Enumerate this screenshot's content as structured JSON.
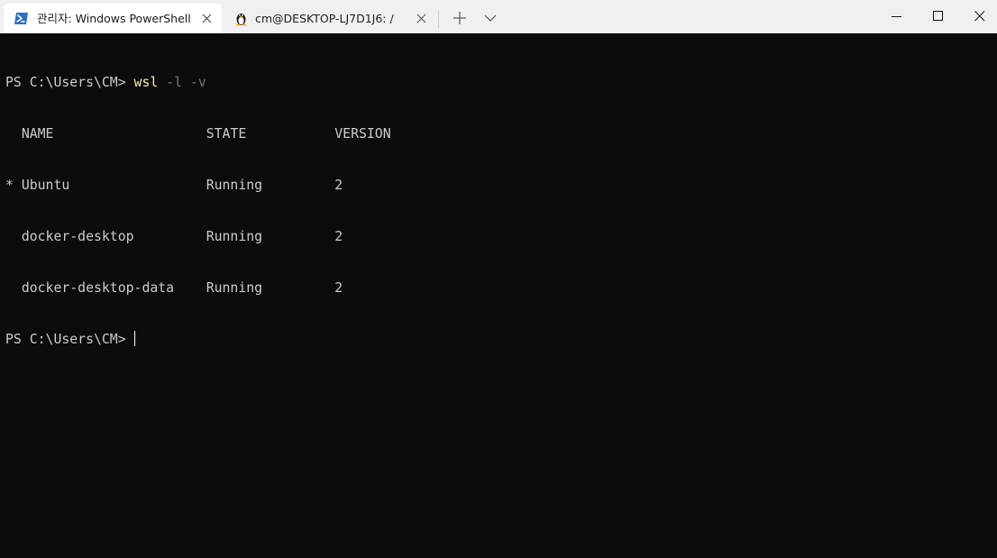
{
  "tabs": [
    {
      "title": "관리자: Windows PowerShell",
      "icon": "powershell-icon",
      "active": true
    },
    {
      "title": "cm@DESKTOP-LJ7D1J6: /",
      "icon": "linux-tux-icon",
      "active": false
    }
  ],
  "toolbar": {
    "new_tab_icon": "plus-icon",
    "dropdown_icon": "chevron-down-icon"
  },
  "window_controls": [
    "minimize-icon",
    "maximize-icon",
    "close-icon"
  ],
  "terminal": {
    "prompt": "PS C:\\Users\\CM> ",
    "command": "wsl",
    "command_args": " -l -v",
    "header": "  NAME                   STATE           VERSION",
    "rows": [
      "* Ubuntu                 Running         2",
      "  docker-desktop         Running         2",
      "  docker-desktop-data    Running         2"
    ],
    "final_prompt": "PS C:\\Users\\CM> "
  },
  "colors": {
    "terminal_bg": "#0c0c0c",
    "terminal_fg": "#cccccc",
    "command_color": "#f9f1a5",
    "args_color": "#767676",
    "tabbar_bg": "#f0f0f0",
    "active_tab_bg": "#ffffff",
    "powershell_icon": "#2d6fc4"
  }
}
